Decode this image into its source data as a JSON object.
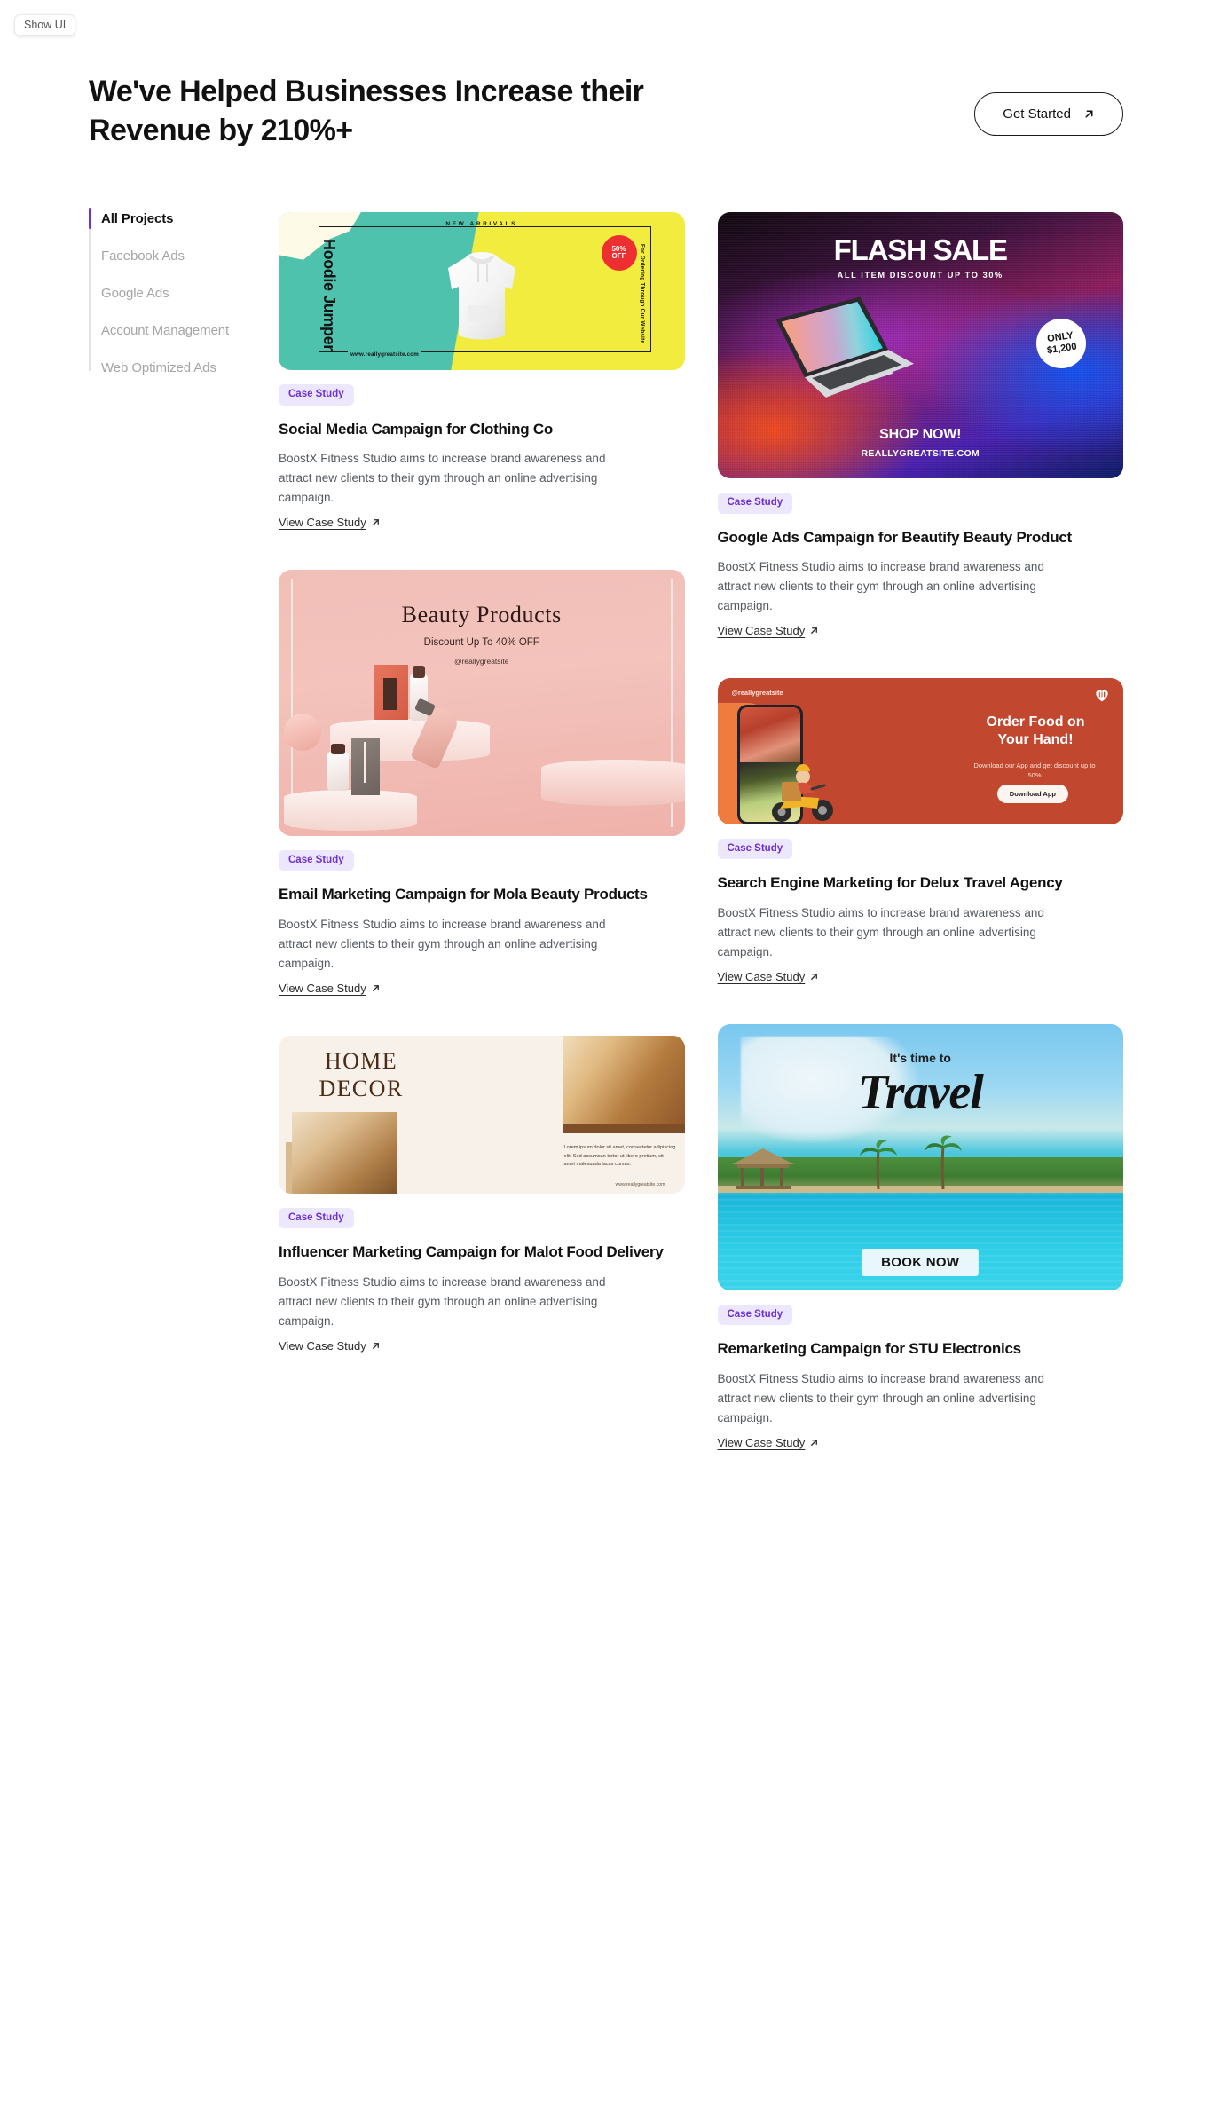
{
  "overlay": {
    "show_ui_label": "Show UI"
  },
  "hero": {
    "title": "We've Helped Businesses Increase their Revenue by 210%+",
    "cta_label": "Get Started"
  },
  "sidebar": {
    "items": [
      {
        "label": "All Projects",
        "active": true
      },
      {
        "label": "Facebook Ads",
        "active": false
      },
      {
        "label": "Google Ads",
        "active": false
      },
      {
        "label": "Account Management",
        "active": false
      },
      {
        "label": "Web Optimized Ads",
        "active": false
      }
    ]
  },
  "colors": {
    "accent_purple": "#6D2FD6",
    "badge_bg": "#ECE7FD",
    "text_primary": "#111111",
    "text_muted": "#555A5F",
    "nav_inactive": "#A5A5A5"
  },
  "cards": [
    {
      "id": "clothing-co",
      "badge": "Case Study",
      "title": "Social Media Campaign for Clothing Co",
      "description": "BoostX Fitness Studio aims to increase brand awareness and attract new clients to their gym through an online advertising campaign.",
      "link_label": "View Case Study",
      "artwork": {
        "name": "hoodie-jumper-ad",
        "headline": "NEW ARRIVALS",
        "product_name": "Hoodie Jumper",
        "side_text": "For Ordering Through Our Website",
        "discount_top": "50%",
        "discount_bottom": "OFF",
        "url": "www.reallygreatsite.com"
      }
    },
    {
      "id": "beautify",
      "badge": "Case Study",
      "title": "Google Ads Campaign for Beautify Beauty Product",
      "description": "BoostX Fitness Studio aims to increase brand awareness and attract new clients to their gym through an online advertising campaign.",
      "link_label": "View Case Study",
      "artwork": {
        "name": "flash-sale-ad",
        "headline": "FLASH SALE",
        "subhead": "ALL ITEM DISCOUNT UP TO 30%",
        "price_badge_top": "ONLY",
        "price_badge_bottom": "$1,200",
        "cta": "SHOP NOW!",
        "url": "REALLYGREATSITE.COM"
      }
    },
    {
      "id": "mola-beauty",
      "badge": "Case Study",
      "title": "Email Marketing Campaign for Mola Beauty Products",
      "description": "BoostX Fitness Studio aims to increase brand awareness and attract new clients to their gym through an online advertising campaign.",
      "link_label": "View Case Study",
      "artwork": {
        "name": "beauty-products-ad",
        "headline": "Beauty Products",
        "subhead": "Discount Up To 40% OFF",
        "handle": "@reallygreatsite"
      }
    },
    {
      "id": "delux-travel",
      "badge": "Case Study",
      "title": "Search Engine Marketing for Delux Travel Agency",
      "description": "BoostX Fitness Studio aims to increase brand awareness and attract new clients to their gym through an online advertising campaign.",
      "link_label": "View Case Study",
      "artwork": {
        "name": "order-food-ad",
        "handle": "@reallygreatsite",
        "headline": "Order Food on Your Hand!",
        "subhead": "Download our App and get discount up to 50%",
        "button": "Download App"
      }
    },
    {
      "id": "malot-food",
      "badge": "Case Study",
      "title": "Influencer Marketing Campaign for Malot Food Delivery",
      "description": "BoostX Fitness Studio aims to increase brand awareness and attract new clients to their gym through an online advertising campaign.",
      "link_label": "View Case Study",
      "artwork": {
        "name": "home-decor-ad",
        "headline": "HOME DECOR",
        "body": "Lorem ipsum dolor sit amet, consectetur adipiscing elit. Sed accumsan tortor ut libero pretium, sit amet malesuada lacus cursus.",
        "url": "www.reallygreatsite.com"
      }
    },
    {
      "id": "stu-electronics",
      "badge": "Case Study",
      "title": "Remarketing Campaign for STU Electronics",
      "description": "BoostX Fitness Studio aims to increase brand awareness and attract new clients to their gym through an online advertising campaign.",
      "link_label": "View Case Study",
      "artwork": {
        "name": "travel-ad",
        "line1": "It's time to",
        "line2": "Travel",
        "button": "BOOK NOW"
      }
    }
  ]
}
